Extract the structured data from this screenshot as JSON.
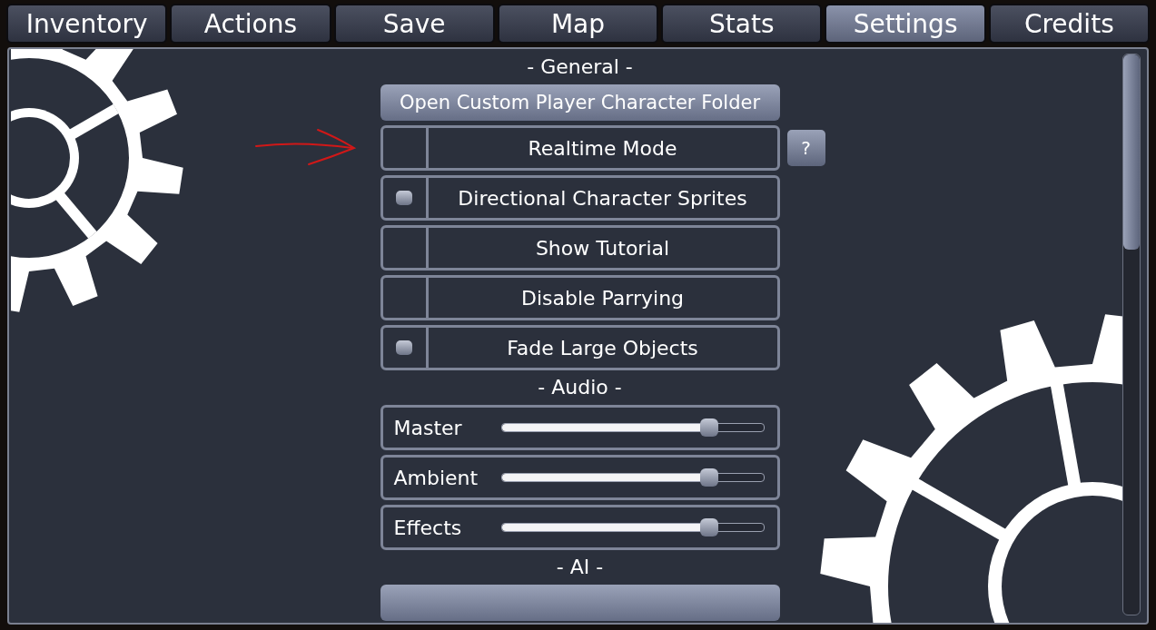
{
  "tabs": [
    {
      "label": "Inventory",
      "selected": false
    },
    {
      "label": "Actions",
      "selected": false
    },
    {
      "label": "Save",
      "selected": false
    },
    {
      "label": "Map",
      "selected": false
    },
    {
      "label": "Stats",
      "selected": false
    },
    {
      "label": "Settings",
      "selected": true
    },
    {
      "label": "Credits",
      "selected": false
    }
  ],
  "sections": [
    {
      "heading": "- General -",
      "items": [
        {
          "kind": "button",
          "label": "Open Custom Player Character Folder"
        },
        {
          "kind": "toggle",
          "label": "Realtime Mode",
          "checked": false,
          "help": "?"
        },
        {
          "kind": "toggle",
          "label": "Directional Character Sprites",
          "checked": true
        },
        {
          "kind": "toggle",
          "label": "Show Tutorial",
          "checked": false
        },
        {
          "kind": "toggle",
          "label": "Disable Parrying",
          "checked": false
        },
        {
          "kind": "toggle",
          "label": "Fade Large Objects",
          "checked": true
        }
      ]
    },
    {
      "heading": "- Audio -",
      "items": [
        {
          "kind": "slider",
          "label": "Master",
          "level": 0.79
        },
        {
          "kind": "slider",
          "label": "Ambient",
          "level": 0.79
        },
        {
          "kind": "slider",
          "label": "Effects",
          "level": 0.79
        }
      ]
    },
    {
      "heading": "- AI -",
      "items": [
        {
          "kind": "cutoff"
        }
      ]
    }
  ]
}
